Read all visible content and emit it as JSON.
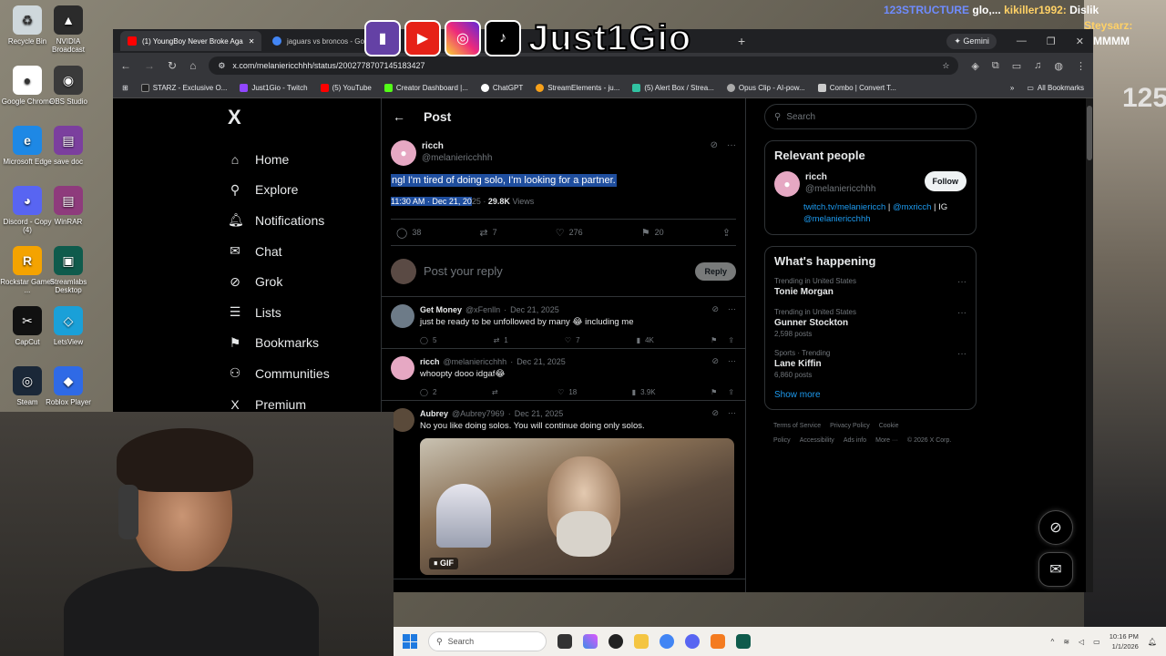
{
  "overlay": {
    "brand_name": "Just1Gio",
    "chat_lines": [
      {
        "user": "123STRUCTURE",
        "msg": "glo,...",
        "extra_user": "kikiller1992:",
        "extra_msg": "Dislik"
      },
      {
        "user": "",
        "msg": "",
        "extra_user": "Steysarz:",
        "extra_msg": ""
      },
      {
        "user": "",
        "msg": "",
        "extra_user": "",
        "extra_msg": "MMMMM"
      }
    ],
    "right_counter": "125"
  },
  "desktop_icons": [
    {
      "label": "Recycle Bin",
      "glyph": "♻",
      "color": "#cfd8dc"
    },
    {
      "label": "NVIDIA Broadcast",
      "glyph": "▲",
      "color": "#2b2b2b"
    },
    {
      "label": "Google Chrome",
      "glyph": "●",
      "color": "#ffffff"
    },
    {
      "label": "OBS Studio",
      "glyph": "◉",
      "color": "#3a3a3a"
    },
    {
      "label": "Microsoft Edge",
      "glyph": "e",
      "color": "#1e88e5"
    },
    {
      "label": "save doc",
      "glyph": "▤",
      "color": "#7b3f9e"
    },
    {
      "label": "Discord - Copy (4)",
      "glyph": "◕",
      "color": "#5865f2"
    },
    {
      "label": "WinRAR",
      "glyph": "▤",
      "color": "#8e3b7c"
    },
    {
      "label": "Rockstar Games ...",
      "glyph": "R",
      "color": "#f4a300"
    },
    {
      "label": "Streamlabs Desktop",
      "glyph": "▣",
      "color": "#0f5b4c"
    },
    {
      "label": "CapCut",
      "glyph": "✂",
      "color": "#111111"
    },
    {
      "label": "LetsView",
      "glyph": "◇",
      "color": "#1aa0d8"
    },
    {
      "label": "Steam",
      "glyph": "◎",
      "color": "#1b2838"
    },
    {
      "label": "Roblox Player",
      "glyph": "◆",
      "color": "#2f6ae6"
    }
  ],
  "browser": {
    "tabs": [
      {
        "title": "(1) YoungBoy Never Broke Aga",
        "fav_color": "#ff0000",
        "active": true
      },
      {
        "title": "jaguars vs broncos - Goo",
        "fav_color": "#4285f4",
        "active": false
      }
    ],
    "gemini_label": "Gemini",
    "url": "x.com/melaniericchhh/status/2002778707145183427",
    "bookmarks": [
      {
        "label": "STARZ - Exclusive O...",
        "color": "#222"
      },
      {
        "label": "Just1Gio - Twitch",
        "color": "#9146ff"
      },
      {
        "label": "(5) YouTube",
        "color": "#ff0000"
      },
      {
        "label": "Creator Dashboard |...",
        "color": "#53fc18"
      },
      {
        "label": "ChatGPT",
        "color": "#ffffff"
      },
      {
        "label": "StreamElements - ju...",
        "color": "#f7a11a"
      },
      {
        "label": "(5) Alert Box / Strea...",
        "color": "#31c3a2"
      },
      {
        "label": "Opus Clip - AI-pow...",
        "color": "#aaaaaa"
      },
      {
        "label": "Combo | Convert T...",
        "color": "#cccccc"
      }
    ],
    "all_bookmarks": "All Bookmarks"
  },
  "nav": {
    "logo": "X",
    "items": [
      {
        "label": "Home",
        "icon": "⌂",
        "name": "home"
      },
      {
        "label": "Explore",
        "icon": "⚲",
        "name": "explore"
      },
      {
        "label": "Notifications",
        "icon": "🔔︎",
        "name": "notifications"
      },
      {
        "label": "Chat",
        "icon": "✉",
        "name": "chat"
      },
      {
        "label": "Grok",
        "icon": "⊘",
        "name": "grok"
      },
      {
        "label": "Lists",
        "icon": "☰",
        "name": "lists"
      },
      {
        "label": "Bookmarks",
        "icon": "⚑",
        "name": "bookmarks"
      },
      {
        "label": "Communities",
        "icon": "⚇",
        "name": "communities"
      },
      {
        "label": "Premium",
        "icon": "X",
        "name": "premium"
      }
    ]
  },
  "post": {
    "header": "Post",
    "display_name": "ricch",
    "handle": "@melaniericchhh",
    "text": "ngl I'm tired of doing solo, I'm looking for a partner.",
    "time_selected": "11:30 AM · Dec 21, 20",
    "time_rest": "25",
    "views_count": "29.8K",
    "views_label": "Views",
    "replies": "38",
    "reposts": "7",
    "likes": "276",
    "bookmarks": "20",
    "reply_placeholder": "Post your reply",
    "reply_button": "Reply"
  },
  "replies": [
    {
      "name": "Get Money",
      "handle": "@xFenlln",
      "date": "Dec 21, 2025",
      "text": "just be ready to be unfollowed by many 😂 including me",
      "replies": "5",
      "reposts": "1",
      "likes": "7",
      "views": "4K",
      "avatar_color": "#6d7b88"
    },
    {
      "name": "ricch",
      "handle": "@melaniericchhh",
      "date": "Dec 21, 2025",
      "text": "whoopty dooo idgaf😂",
      "replies": "2",
      "reposts": "",
      "likes": "18",
      "views": "3.9K",
      "avatar_color": "#e6a8c3"
    },
    {
      "name": "Aubrey",
      "handle": "@Aubrey7969",
      "date": "Dec 21, 2025",
      "text": "No you like doing solos. You will continue doing only solos.",
      "gif_label": "GIF",
      "avatar_color": "#5a4a3a"
    }
  ],
  "right": {
    "search_placeholder": "Search",
    "relevant_title": "Relevant people",
    "rp_name": "ricch",
    "rp_handle": "@melaniericchhh",
    "follow_label": "Follow",
    "rp_link1": "twitch.tv/melaniericch",
    "rp_sep1": " | ",
    "rp_link2": "@mxricch",
    "rp_sep2": " | IG ",
    "rp_link3": "@melaniericchhh",
    "happening_title": "What's happening",
    "trends": [
      {
        "context": "Trending in United States",
        "name": "Tonie Morgan",
        "posts": ""
      },
      {
        "context": "Trending in United States",
        "name": "Gunner Stockton",
        "posts": "2,598 posts"
      },
      {
        "context": "Sports · Trending",
        "name": "Lane Kiffin",
        "posts": "6,860 posts"
      }
    ],
    "show_more": "Show more",
    "footer": [
      "Terms of Service",
      "Privacy Policy",
      "Cookie Policy",
      "Accessibility",
      "Ads info",
      "More ···",
      "© 2026 X Corp."
    ]
  },
  "taskbar": {
    "search_label": "Search",
    "time": "10:16 PM",
    "date": "1/1/2026"
  }
}
